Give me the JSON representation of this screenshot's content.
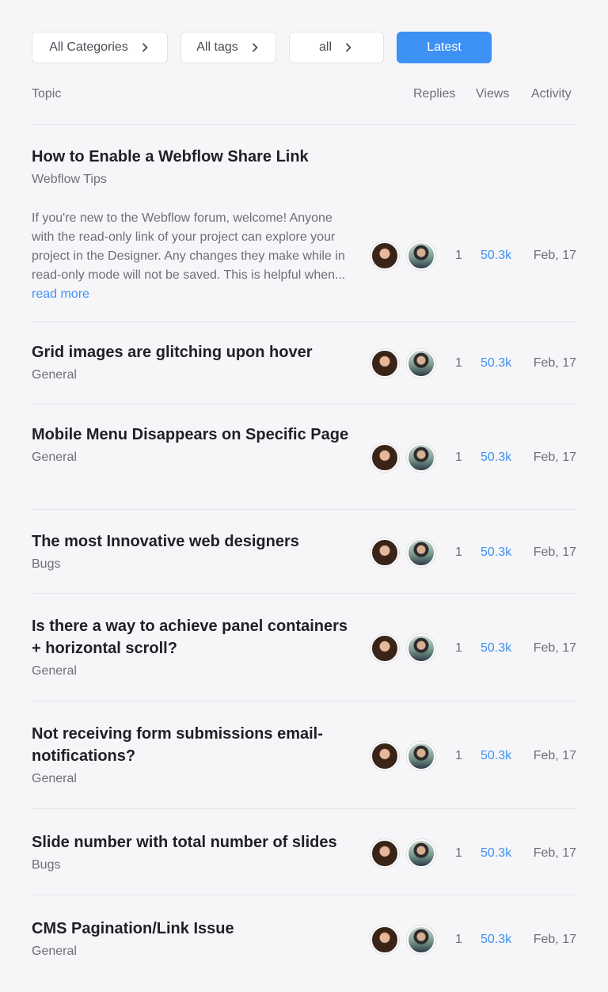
{
  "filters": {
    "categories": "All Categories",
    "tags": "All tags",
    "status": "all",
    "sort": "Latest"
  },
  "table": {
    "headers": {
      "topic": "Topic",
      "replies": "Replies",
      "views": "Views",
      "activity": "Activity"
    }
  },
  "topics": [
    {
      "title": "How to Enable a Webflow Share Link",
      "category": "Webflow Tips",
      "excerpt": "If you're new to the Webflow forum, welcome! Anyone with the read-only link of your project can explore your project in the Designer. Any changes they make while in read-only mode will not be saved. This is helpful when...",
      "read_more": "read more",
      "replies": "1",
      "views": "50.3k",
      "activity": "Feb, 17"
    },
    {
      "title": "Grid images are glitching upon hover",
      "category": "General",
      "replies": "1",
      "views": "50.3k",
      "activity": "Feb, 17"
    },
    {
      "title": "Mobile Menu Disappears on Specific Page",
      "category": "General",
      "replies": "1",
      "views": "50.3k",
      "activity": "Feb, 17"
    },
    {
      "title": "The most Innovative web designers",
      "category": "Bugs",
      "replies": "1",
      "views": "50.3k",
      "activity": "Feb, 17"
    },
    {
      "title": "Is there a way to achieve panel containers + horizontal scroll?",
      "category": "General",
      "replies": "1",
      "views": "50.3k",
      "activity": "Feb, 17"
    },
    {
      "title": "Not receiving form submissions email-notifications?",
      "category": "General",
      "replies": "1",
      "views": "50.3k",
      "activity": "Feb, 17"
    },
    {
      "title": "Slide number with total number of slides",
      "category": "Bugs",
      "replies": "1",
      "views": "50.3k",
      "activity": "Feb, 17"
    },
    {
      "title": "CMS Pagination/Link Issue",
      "category": "General",
      "replies": "1",
      "views": "50.3k",
      "activity": "Feb, 17"
    }
  ],
  "colors": {
    "accent": "#3d91f4",
    "background": "#f6f6f9",
    "text": "#1f2024",
    "muted": "#6c6e78"
  },
  "icons": {
    "filter_chevron": "chevron-right-icon"
  }
}
